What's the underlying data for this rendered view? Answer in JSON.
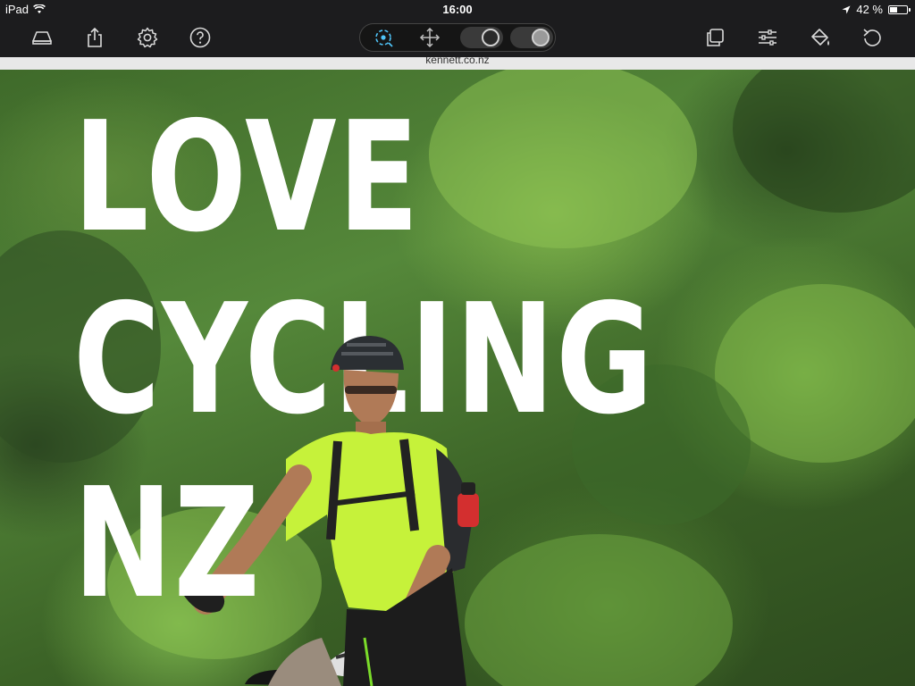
{
  "status_bar": {
    "device": "iPad",
    "time": "16:00",
    "battery_percent": "42 %",
    "battery_level": 0.42
  },
  "toolbar": {
    "left_icons": [
      "layout-icon",
      "share-icon",
      "settings-icon",
      "help-icon"
    ],
    "mode_icons": [
      "zoom-select-icon",
      "move-icon"
    ],
    "right_icons": [
      "copy-icon",
      "adjust-icon",
      "paint-bucket-icon",
      "refresh-icon"
    ],
    "accent": "#4fc3f7"
  },
  "page": {
    "url_text": "kennett.co.nz"
  },
  "hero": {
    "line1": "LOVE",
    "line2": "CYCLING",
    "line3": "NZ"
  },
  "colors": {
    "toolbar_bg": "#1c1c1e",
    "jersey": "#c6f23a",
    "headline": "#ffffff"
  }
}
